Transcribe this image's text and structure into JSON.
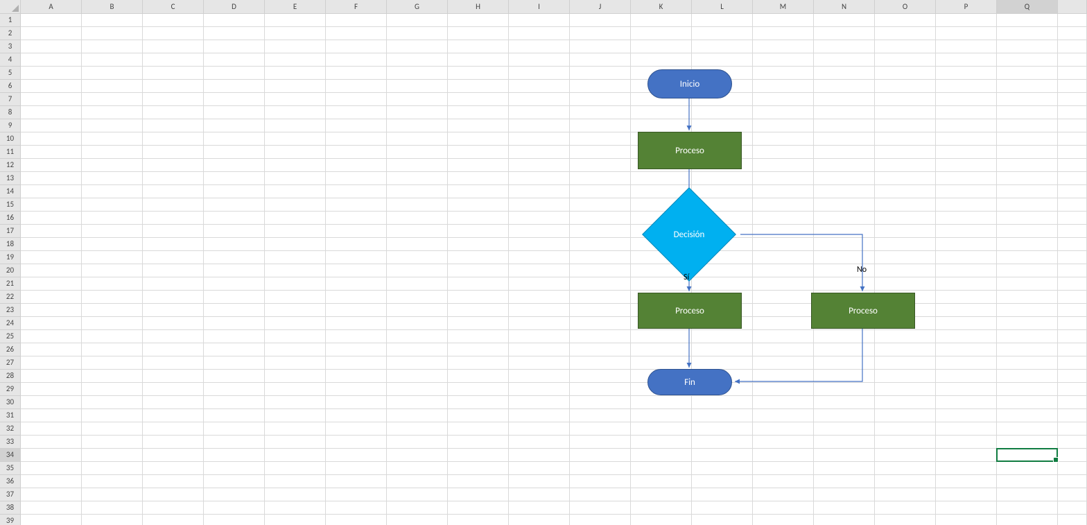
{
  "columns": [
    "A",
    "B",
    "C",
    "D",
    "E",
    "F",
    "G",
    "H",
    "I",
    "J",
    "K",
    "L",
    "M",
    "N",
    "O",
    "P",
    "Q"
  ],
  "rowCount": 39,
  "activeCell": {
    "col": "Q",
    "row": 34
  },
  "flowchart": {
    "start": "Inicio",
    "process1": "Proceso",
    "decision": "Decisión",
    "branchYes": "Sí",
    "branchNo": "No",
    "processYes": "Proceso",
    "processNo": "Proceso",
    "end": "Fin"
  },
  "colors": {
    "terminator": "#4472c4",
    "process": "#548235",
    "decision": "#00b0f0",
    "connector": "#4472c4"
  }
}
